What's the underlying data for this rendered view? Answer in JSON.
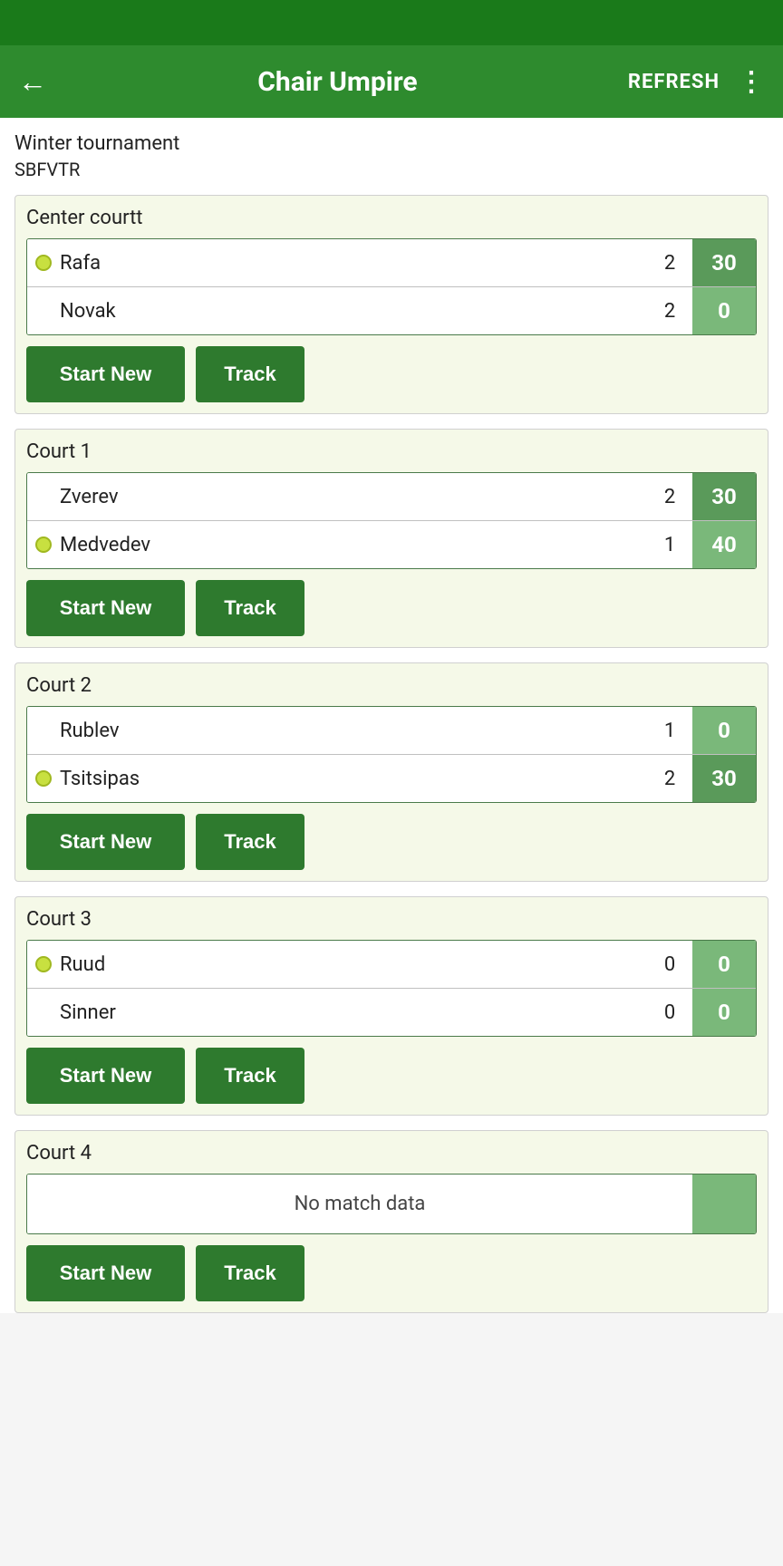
{
  "statusBar": {},
  "toolbar": {
    "backLabel": "←",
    "title": "Chair Umpire",
    "refreshLabel": "REFRESH",
    "moreLabel": "⋮"
  },
  "page": {
    "tournamentName": "Winter tournament",
    "tournamentCode": "SBFVTR"
  },
  "courts": [
    {
      "id": "center-court",
      "name": "Center courtt",
      "players": [
        {
          "name": "Rafa",
          "sets": "2",
          "points": "30",
          "hasBall": true,
          "pointsDim": false
        },
        {
          "name": "Novak",
          "sets": "2",
          "points": "0",
          "hasBall": false,
          "pointsDim": true
        }
      ],
      "startNewLabel": "Start New",
      "trackLabel": "Track",
      "noMatch": false
    },
    {
      "id": "court-1",
      "name": "Court 1",
      "players": [
        {
          "name": "Zverev",
          "sets": "2",
          "points": "30",
          "hasBall": false,
          "pointsDim": false
        },
        {
          "name": "Medvedev",
          "sets": "1",
          "points": "40",
          "hasBall": true,
          "pointsDim": true
        }
      ],
      "startNewLabel": "Start New",
      "trackLabel": "Track",
      "noMatch": false
    },
    {
      "id": "court-2",
      "name": "Court 2",
      "players": [
        {
          "name": "Rublev",
          "sets": "1",
          "points": "0",
          "hasBall": false,
          "pointsDim": true
        },
        {
          "name": "Tsitsipas",
          "sets": "2",
          "points": "30",
          "hasBall": true,
          "pointsDim": false
        }
      ],
      "startNewLabel": "Start New",
      "trackLabel": "Track",
      "noMatch": false
    },
    {
      "id": "court-3",
      "name": "Court 3",
      "players": [
        {
          "name": "Ruud",
          "sets": "0",
          "points": "0",
          "hasBall": true,
          "pointsDim": true
        },
        {
          "name": "Sinner",
          "sets": "0",
          "points": "0",
          "hasBall": false,
          "pointsDim": true
        }
      ],
      "startNewLabel": "Start New",
      "trackLabel": "Track",
      "noMatch": false
    },
    {
      "id": "court-4",
      "name": "Court 4",
      "players": [],
      "noMatchLabel": "No match data",
      "startNewLabel": "Start New",
      "trackLabel": "Track",
      "noMatch": true
    }
  ]
}
